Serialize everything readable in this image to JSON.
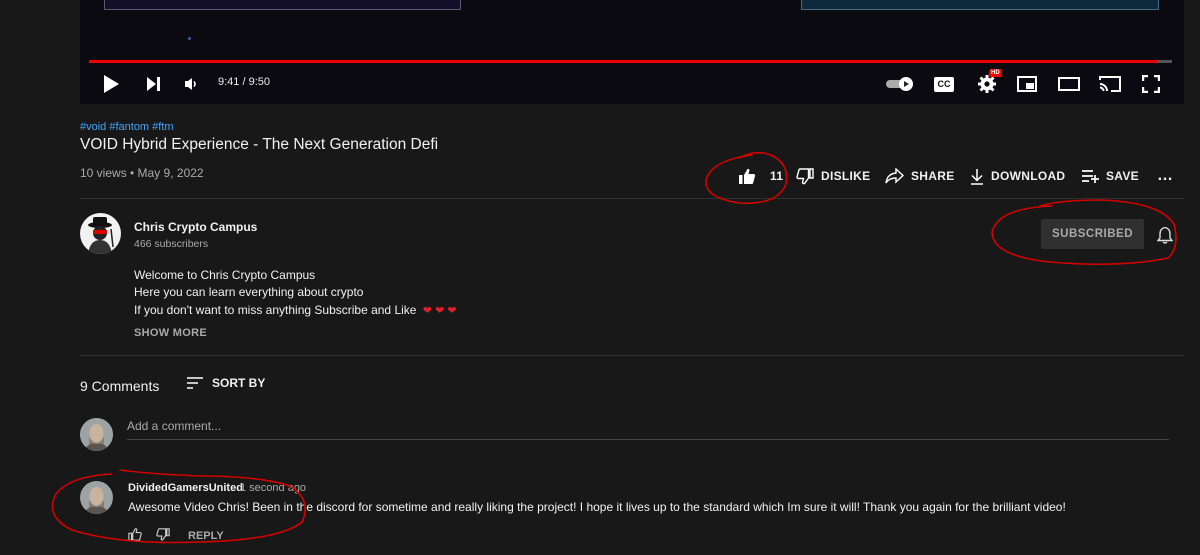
{
  "player": {
    "time": "9:41 / 9:50",
    "progress_fraction": 0.986,
    "icons": [
      "play-icon",
      "next-icon",
      "volume-icon",
      "autoplay-toggle-icon",
      "captions-icon",
      "settings-icon",
      "miniplayer-icon",
      "theater-icon",
      "cast-icon",
      "fullscreen-icon"
    ],
    "cc_label": "CC",
    "hd_badge": "HD"
  },
  "video": {
    "tags": "#void #fantom #ftm",
    "title": "VOID Hybrid Experience - The Next Generation Defi",
    "meta": "10 views • May 9, 2022"
  },
  "actions": {
    "like_count": "11",
    "dislike": "DISLIKE",
    "share": "SHARE",
    "download": "DOWNLOAD",
    "save": "SAVE",
    "more": "…"
  },
  "channel": {
    "name": "Chris Crypto Campus",
    "subscribers": "466 subscribers",
    "subscribe_label": "SUBSCRIBED",
    "description": [
      "Welcome to Chris Crypto Campus",
      "Here you can learn everything about crypto",
      "If you don't want to miss anything Subscribe and Like"
    ],
    "hearts": "❤ ❤ ❤",
    "show_more": "SHOW MORE"
  },
  "comments": {
    "count_label": "9 Comments",
    "sort_label": "SORT BY",
    "add_placeholder": "Add a comment...",
    "items": [
      {
        "author": "DividedGamersUnited",
        "time": "1 second ago",
        "text": "Awesome Video Chris! Been in the discord for sometime and really liking the project! I hope it lives up to the standard which Im sure it will! Thank you again for the brilliant video!",
        "reply_label": "REPLY"
      }
    ]
  },
  "colors": {
    "background": "#181818",
    "progress": "#ff0000",
    "link": "#3ea6ff",
    "annotation": "#d40000"
  }
}
